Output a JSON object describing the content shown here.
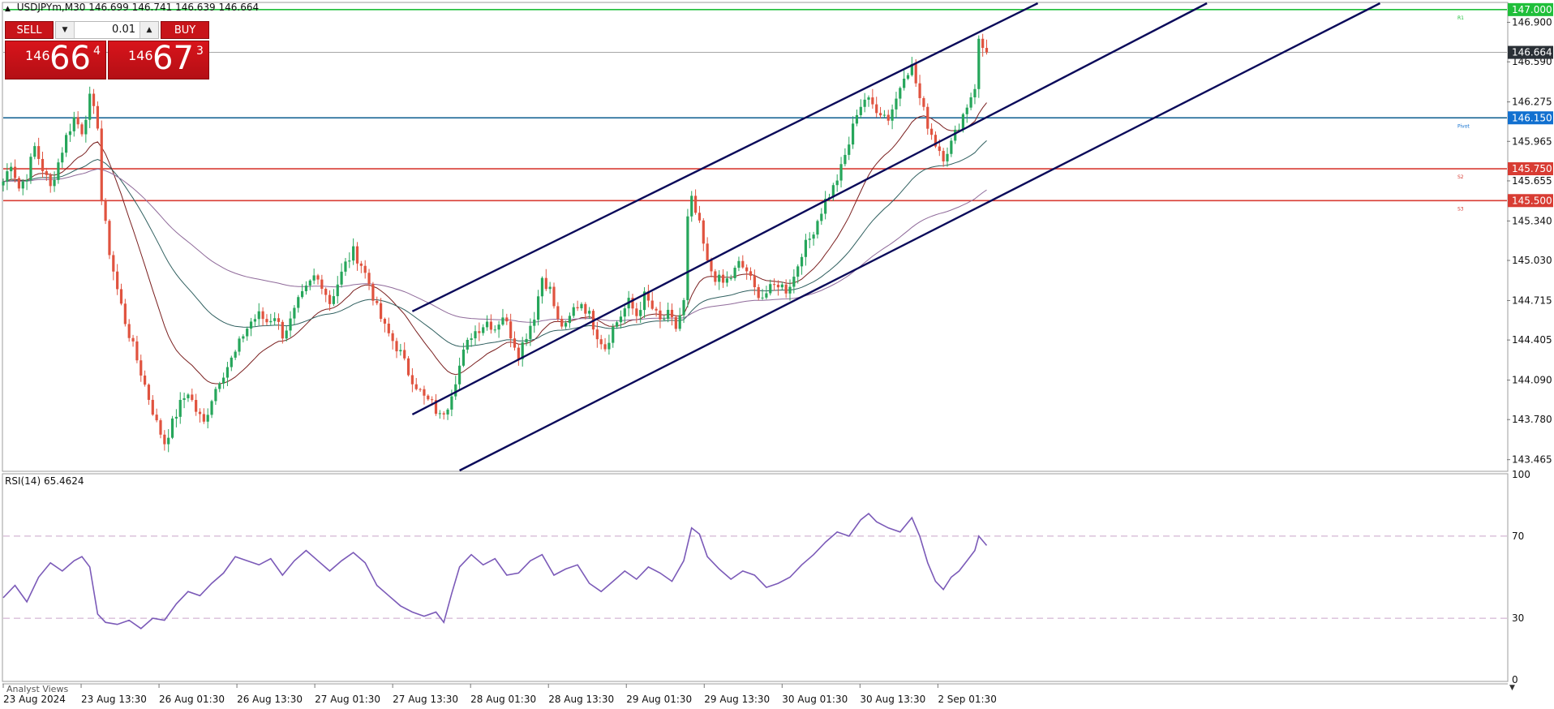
{
  "header": {
    "symbol": "USDJPYm,M30",
    "quote": "146.699 146.741 146.639 146.664"
  },
  "trade_panel": {
    "sell_label": "SELL",
    "buy_label": "BUY",
    "lot": "0.01",
    "sell_price": {
      "big": "146",
      "main": "66",
      "sup": "4"
    },
    "buy_price": {
      "big": "146",
      "main": "67",
      "sup": "3"
    }
  },
  "colors": {
    "bull": "#26a65b",
    "bear": "#e0533f",
    "channel": "#0a0a5a",
    "r1_level": "#1fbf3a",
    "pivot": "#0b5c8f",
    "support": "#d83c33",
    "rsi": "#7b5ab8",
    "ma1": "#7a1f1f",
    "ma2": "#2f5f5f",
    "ma3": "#8f6a9a",
    "current": "#555555"
  },
  "price_axis_labels": [
    "146.900",
    "146.590",
    "146.275",
    "145.965",
    "145.655",
    "145.340",
    "145.030",
    "144.715",
    "144.405",
    "144.090",
    "143.780",
    "143.465"
  ],
  "price_tags": [
    {
      "price": 147.0,
      "text": "147.000",
      "color": "#1fbf3a",
      "line": "#1fbf3a",
      "level_name": "R1"
    },
    {
      "price": 146.664,
      "text": "146.664",
      "color": "#2a3036",
      "line": "#9a9a9a",
      "level_name": ""
    },
    {
      "price": 146.15,
      "text": "146.150",
      "color": "#1170d0",
      "line": "#0b5c8f",
      "level_name": "Pivot"
    },
    {
      "price": 145.75,
      "text": "145.750",
      "color": "#d83c33",
      "line": "#d83c33",
      "level_name": "S2"
    },
    {
      "price": 145.5,
      "text": "145.500",
      "color": "#d83c33",
      "line": "#d83c33",
      "level_name": "S3"
    }
  ],
  "rsi": {
    "label": "RSI(14) 65.4624",
    "axis_labels": [
      "100",
      "70",
      "30",
      "0"
    ]
  },
  "time_axis_labels": [
    "23 Aug 2024",
    "23 Aug 13:30",
    "26 Aug 01:30",
    "26 Aug 13:30",
    "27 Aug 01:30",
    "27 Aug 13:30",
    "28 Aug 01:30",
    "28 Aug 13:30",
    "29 Aug 01:30",
    "29 Aug 13:30",
    "30 Aug 01:30",
    "30 Aug 13:30",
    "2 Sep 01:30"
  ],
  "analyst_label": "Analyst Views",
  "chart_data": {
    "type": "line",
    "title": "USDJPYm,M30",
    "ylim": [
      143.38,
      147.05
    ],
    "rsi_ylim": [
      0,
      100
    ],
    "rsi_levels": [
      70,
      30
    ],
    "close_path": [
      {
        "x": 0,
        "y": 145.65
      },
      {
        "x": 2,
        "y": 145.8
      },
      {
        "x": 4,
        "y": 145.6
      },
      {
        "x": 6,
        "y": 145.7
      },
      {
        "x": 8,
        "y": 145.92
      },
      {
        "x": 10,
        "y": 145.75
      },
      {
        "x": 12,
        "y": 145.6
      },
      {
        "x": 14,
        "y": 145.8
      },
      {
        "x": 16,
        "y": 146.0
      },
      {
        "x": 18,
        "y": 146.15
      },
      {
        "x": 20,
        "y": 146.05
      },
      {
        "x": 22,
        "y": 146.3
      },
      {
        "x": 24,
        "y": 146.1
      },
      {
        "x": 25,
        "y": 145.5
      },
      {
        "x": 27,
        "y": 145.1
      },
      {
        "x": 29,
        "y": 144.8
      },
      {
        "x": 31,
        "y": 144.55
      },
      {
        "x": 33,
        "y": 144.35
      },
      {
        "x": 35,
        "y": 144.15
      },
      {
        "x": 37,
        "y": 143.95
      },
      {
        "x": 39,
        "y": 143.75
      },
      {
        "x": 41,
        "y": 143.6
      },
      {
        "x": 43,
        "y": 143.75
      },
      {
        "x": 45,
        "y": 143.9
      },
      {
        "x": 47,
        "y": 144.0
      },
      {
        "x": 49,
        "y": 143.85
      },
      {
        "x": 51,
        "y": 143.75
      },
      {
        "x": 53,
        "y": 143.95
      },
      {
        "x": 55,
        "y": 144.1
      },
      {
        "x": 57,
        "y": 144.2
      },
      {
        "x": 59,
        "y": 144.3
      },
      {
        "x": 61,
        "y": 144.45
      },
      {
        "x": 63,
        "y": 144.55
      },
      {
        "x": 65,
        "y": 144.6
      },
      {
        "x": 67,
        "y": 144.55
      },
      {
        "x": 69,
        "y": 144.6
      },
      {
        "x": 71,
        "y": 144.45
      },
      {
        "x": 73,
        "y": 144.55
      },
      {
        "x": 75,
        "y": 144.7
      },
      {
        "x": 77,
        "y": 144.8
      },
      {
        "x": 79,
        "y": 144.9
      },
      {
        "x": 81,
        "y": 144.85
      },
      {
        "x": 83,
        "y": 144.7
      },
      {
        "x": 85,
        "y": 144.85
      },
      {
        "x": 87,
        "y": 145.0
      },
      {
        "x": 89,
        "y": 145.1
      },
      {
        "x": 91,
        "y": 145.0
      },
      {
        "x": 93,
        "y": 144.85
      },
      {
        "x": 95,
        "y": 144.65
      },
      {
        "x": 97,
        "y": 144.5
      },
      {
        "x": 99,
        "y": 144.4
      },
      {
        "x": 101,
        "y": 144.3
      },
      {
        "x": 103,
        "y": 144.15
      },
      {
        "x": 105,
        "y": 144.05
      },
      {
        "x": 107,
        "y": 143.95
      },
      {
        "x": 109,
        "y": 143.9
      },
      {
        "x": 111,
        "y": 143.8
      },
      {
        "x": 113,
        "y": 143.9
      },
      {
        "x": 115,
        "y": 144.1
      },
      {
        "x": 117,
        "y": 144.3
      },
      {
        "x": 119,
        "y": 144.45
      },
      {
        "x": 121,
        "y": 144.5
      },
      {
        "x": 123,
        "y": 144.55
      },
      {
        "x": 125,
        "y": 144.5
      },
      {
        "x": 127,
        "y": 144.6
      },
      {
        "x": 129,
        "y": 144.45
      },
      {
        "x": 131,
        "y": 144.3
      },
      {
        "x": 133,
        "y": 144.45
      },
      {
        "x": 135,
        "y": 144.6
      },
      {
        "x": 137,
        "y": 144.9
      },
      {
        "x": 139,
        "y": 144.8
      },
      {
        "x": 141,
        "y": 144.55
      },
      {
        "x": 143,
        "y": 144.5
      },
      {
        "x": 145,
        "y": 144.65
      },
      {
        "x": 147,
        "y": 144.7
      },
      {
        "x": 149,
        "y": 144.6
      },
      {
        "x": 151,
        "y": 144.45
      },
      {
        "x": 153,
        "y": 144.35
      },
      {
        "x": 155,
        "y": 144.5
      },
      {
        "x": 157,
        "y": 144.6
      },
      {
        "x": 159,
        "y": 144.7
      },
      {
        "x": 161,
        "y": 144.6
      },
      {
        "x": 163,
        "y": 144.75
      },
      {
        "x": 165,
        "y": 144.65
      },
      {
        "x": 167,
        "y": 144.55
      },
      {
        "x": 169,
        "y": 144.6
      },
      {
        "x": 171,
        "y": 144.5
      },
      {
        "x": 173,
        "y": 144.7
      },
      {
        "x": 174,
        "y": 145.35
      },
      {
        "x": 175,
        "y": 145.5
      },
      {
        "x": 177,
        "y": 145.3
      },
      {
        "x": 179,
        "y": 145.0
      },
      {
        "x": 181,
        "y": 144.9
      },
      {
        "x": 183,
        "y": 144.85
      },
      {
        "x": 185,
        "y": 144.9
      },
      {
        "x": 187,
        "y": 145.0
      },
      {
        "x": 189,
        "y": 144.95
      },
      {
        "x": 191,
        "y": 144.8
      },
      {
        "x": 193,
        "y": 144.75
      },
      {
        "x": 195,
        "y": 144.8
      },
      {
        "x": 197,
        "y": 144.85
      },
      {
        "x": 199,
        "y": 144.8
      },
      {
        "x": 201,
        "y": 144.9
      },
      {
        "x": 203,
        "y": 145.1
      },
      {
        "x": 205,
        "y": 145.2
      },
      {
        "x": 207,
        "y": 145.35
      },
      {
        "x": 209,
        "y": 145.5
      },
      {
        "x": 211,
        "y": 145.6
      },
      {
        "x": 213,
        "y": 145.75
      },
      {
        "x": 215,
        "y": 145.95
      },
      {
        "x": 217,
        "y": 146.2
      },
      {
        "x": 219,
        "y": 146.3
      },
      {
        "x": 221,
        "y": 146.25
      },
      {
        "x": 223,
        "y": 146.2
      },
      {
        "x": 225,
        "y": 146.15
      },
      {
        "x": 227,
        "y": 146.3
      },
      {
        "x": 229,
        "y": 146.5
      },
      {
        "x": 231,
        "y": 146.55
      },
      {
        "x": 233,
        "y": 146.3
      },
      {
        "x": 235,
        "y": 146.1
      },
      {
        "x": 237,
        "y": 145.95
      },
      {
        "x": 239,
        "y": 145.85
      },
      {
        "x": 241,
        "y": 145.95
      },
      {
        "x": 243,
        "y": 146.1
      },
      {
        "x": 245,
        "y": 146.25
      },
      {
        "x": 247,
        "y": 146.4
      },
      {
        "x": 248,
        "y": 146.75
      },
      {
        "x": 249,
        "y": 146.7
      },
      {
        "x": 250,
        "y": 146.664
      }
    ],
    "channels": [
      {
        "start": {
          "x": 104,
          "y": 144.63
        },
        "end": {
          "x": 263,
          "y": 147.05
        }
      },
      {
        "start": {
          "x": 104,
          "y": 143.82
        },
        "end": {
          "x": 306,
          "y": 147.05
        }
      },
      {
        "start": {
          "x": 116,
          "y": 143.38
        },
        "end": {
          "x": 350,
          "y": 147.05
        }
      }
    ],
    "rsi_path": [
      {
        "x": 0,
        "y": 40
      },
      {
        "x": 3,
        "y": 46
      },
      {
        "x": 6,
        "y": 38
      },
      {
        "x": 9,
        "y": 50
      },
      {
        "x": 12,
        "y": 57
      },
      {
        "x": 15,
        "y": 53
      },
      {
        "x": 18,
        "y": 58
      },
      {
        "x": 20,
        "y": 60
      },
      {
        "x": 22,
        "y": 55
      },
      {
        "x": 24,
        "y": 32
      },
      {
        "x": 26,
        "y": 28
      },
      {
        "x": 29,
        "y": 27
      },
      {
        "x": 32,
        "y": 29
      },
      {
        "x": 35,
        "y": 25
      },
      {
        "x": 38,
        "y": 30
      },
      {
        "x": 41,
        "y": 29
      },
      {
        "x": 44,
        "y": 37
      },
      {
        "x": 47,
        "y": 43
      },
      {
        "x": 50,
        "y": 41
      },
      {
        "x": 53,
        "y": 47
      },
      {
        "x": 56,
        "y": 52
      },
      {
        "x": 59,
        "y": 60
      },
      {
        "x": 62,
        "y": 58
      },
      {
        "x": 65,
        "y": 56
      },
      {
        "x": 68,
        "y": 59
      },
      {
        "x": 71,
        "y": 51
      },
      {
        "x": 74,
        "y": 58
      },
      {
        "x": 77,
        "y": 63
      },
      {
        "x": 80,
        "y": 58
      },
      {
        "x": 83,
        "y": 53
      },
      {
        "x": 86,
        "y": 58
      },
      {
        "x": 89,
        "y": 62
      },
      {
        "x": 92,
        "y": 57
      },
      {
        "x": 95,
        "y": 46
      },
      {
        "x": 98,
        "y": 41
      },
      {
        "x": 101,
        "y": 36
      },
      {
        "x": 104,
        "y": 33
      },
      {
        "x": 107,
        "y": 31
      },
      {
        "x": 110,
        "y": 33
      },
      {
        "x": 112,
        "y": 28
      },
      {
        "x": 114,
        "y": 42
      },
      {
        "x": 116,
        "y": 55
      },
      {
        "x": 119,
        "y": 61
      },
      {
        "x": 122,
        "y": 56
      },
      {
        "x": 125,
        "y": 59
      },
      {
        "x": 128,
        "y": 51
      },
      {
        "x": 131,
        "y": 52
      },
      {
        "x": 134,
        "y": 58
      },
      {
        "x": 137,
        "y": 61
      },
      {
        "x": 140,
        "y": 51
      },
      {
        "x": 143,
        "y": 54
      },
      {
        "x": 146,
        "y": 56
      },
      {
        "x": 149,
        "y": 47
      },
      {
        "x": 152,
        "y": 43
      },
      {
        "x": 155,
        "y": 48
      },
      {
        "x": 158,
        "y": 53
      },
      {
        "x": 161,
        "y": 49
      },
      {
        "x": 164,
        "y": 55
      },
      {
        "x": 167,
        "y": 52
      },
      {
        "x": 170,
        "y": 48
      },
      {
        "x": 173,
        "y": 58
      },
      {
        "x": 175,
        "y": 74
      },
      {
        "x": 177,
        "y": 71
      },
      {
        "x": 179,
        "y": 60
      },
      {
        "x": 182,
        "y": 54
      },
      {
        "x": 185,
        "y": 49
      },
      {
        "x": 188,
        "y": 53
      },
      {
        "x": 191,
        "y": 51
      },
      {
        "x": 194,
        "y": 45
      },
      {
        "x": 197,
        "y": 47
      },
      {
        "x": 200,
        "y": 50
      },
      {
        "x": 203,
        "y": 56
      },
      {
        "x": 206,
        "y": 61
      },
      {
        "x": 209,
        "y": 67
      },
      {
        "x": 212,
        "y": 72
      },
      {
        "x": 215,
        "y": 70
      },
      {
        "x": 218,
        "y": 78
      },
      {
        "x": 220,
        "y": 81
      },
      {
        "x": 222,
        "y": 77
      },
      {
        "x": 225,
        "y": 74
      },
      {
        "x": 228,
        "y": 72
      },
      {
        "x": 231,
        "y": 79
      },
      {
        "x": 233,
        "y": 70
      },
      {
        "x": 235,
        "y": 57
      },
      {
        "x": 237,
        "y": 48
      },
      {
        "x": 239,
        "y": 44
      },
      {
        "x": 241,
        "y": 50
      },
      {
        "x": 243,
        "y": 53
      },
      {
        "x": 245,
        "y": 58
      },
      {
        "x": 247,
        "y": 63
      },
      {
        "x": 248,
        "y": 70
      },
      {
        "x": 250,
        "y": 65.46
      }
    ]
  }
}
